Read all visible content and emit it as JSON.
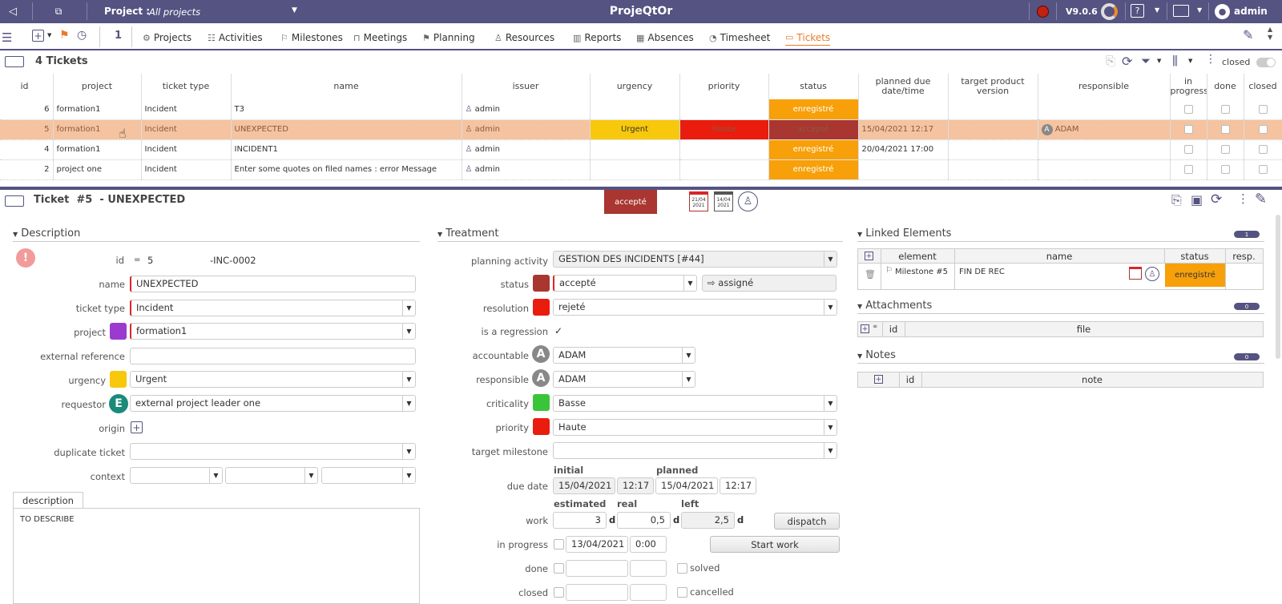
{
  "topbar": {
    "project_label": "Project :",
    "project_value": "All projects",
    "app_title": "ProjeQtOr",
    "version": "V9.0.6",
    "user": "admin"
  },
  "menubar": {
    "number": "1",
    "items": [
      {
        "label": "Projects",
        "icon": "gear-icon"
      },
      {
        "label": "Activities",
        "icon": "activities-icon"
      },
      {
        "label": "Milestones",
        "icon": "flag-icon"
      },
      {
        "label": "Meetings",
        "icon": "meeting-icon"
      },
      {
        "label": "Planning",
        "icon": "planning-icon"
      },
      {
        "label": "Resources",
        "icon": "user-icon"
      },
      {
        "label": "Reports",
        "icon": "reports-icon"
      },
      {
        "label": "Absences",
        "icon": "absence-icon"
      },
      {
        "label": "Timesheet",
        "icon": "timer-icon"
      },
      {
        "label": "Tickets",
        "icon": "ticket-icon"
      }
    ]
  },
  "list": {
    "title": "4 Tickets",
    "closed_label": "closed",
    "columns": [
      "id",
      "project",
      "ticket type",
      "name",
      "issuer",
      "urgency",
      "priority",
      "status",
      "planned due date/time",
      "target product version",
      "responsible",
      "in progress",
      "done",
      "closed"
    ],
    "rows": [
      {
        "id": "6",
        "project": "formation1",
        "type": "Incident",
        "name": "T3",
        "issuer": "admin",
        "urgency": "",
        "priority": "",
        "status": "enregistré",
        "due": "",
        "target": "",
        "responsible": ""
      },
      {
        "id": "5",
        "project": "formation1",
        "type": "Incident",
        "name": "UNEXPECTED",
        "issuer": "admin",
        "urgency": "Urgent",
        "priority": "Haute",
        "status": "accepté",
        "due": "15/04/2021 12:17",
        "target": "",
        "responsible": "ADAM"
      },
      {
        "id": "4",
        "project": "formation1",
        "type": "Incident",
        "name": "INCIDENT1",
        "issuer": "admin",
        "urgency": "",
        "priority": "",
        "status": "enregistré",
        "due": "20/04/2021 17:00",
        "target": "",
        "responsible": ""
      },
      {
        "id": "2",
        "project": "project one",
        "type": "Incident",
        "name": "Enter some quotes on filed names : error Message",
        "issuer": "admin",
        "urgency": "",
        "priority": "",
        "status": "enregistré",
        "due": "",
        "target": "",
        "responsible": ""
      }
    ]
  },
  "detail": {
    "title": "Ticket  #5  - UNEXPECTED",
    "status_badge": "accepté",
    "cal1": "21/04 2021",
    "cal2": "14/04 2021",
    "description": {
      "section": "Description",
      "id_label": "id",
      "id_eq": "=",
      "id_value": "5",
      "ref": "-INC-0002",
      "name_label": "name",
      "name_value": "UNEXPECTED",
      "type_label": "ticket type",
      "type_value": "Incident",
      "project_label": "project",
      "project_value": "formation1",
      "extref_label": "external reference",
      "extref_value": "",
      "urgency_label": "urgency",
      "urgency_value": "Urgent",
      "requestor_label": "requestor",
      "requestor_value": "external project leader one",
      "requestor_initial": "E",
      "origin_label": "origin",
      "duplicate_label": "duplicate ticket",
      "context_label": "context",
      "tab_label": "description",
      "text": "TO DESCRIBE"
    },
    "treatment": {
      "section": "Treatment",
      "planning_label": "planning activity",
      "planning_value": "GESTION DES INCIDENTS [#44]",
      "status_label": "status",
      "status_value": "accepté",
      "next_status": "assigné",
      "resolution_label": "resolution",
      "resolution_value": "rejeté",
      "regression_label": "is a regression",
      "regression_checked": true,
      "accountable_label": "accountable",
      "accountable_value": "ADAM",
      "responsible_label": "responsible",
      "responsible_value": "ADAM",
      "initial_A": "A",
      "criticality_label": "criticality",
      "criticality_value": "Basse",
      "priority_label": "priority",
      "priority_value": "Haute",
      "milestone_label": "target milestone",
      "milestone_value": "",
      "initial_head": "initial",
      "planned_head": "planned",
      "due_label": "due date",
      "due_init_date": "15/04/2021",
      "due_init_time": "12:17",
      "due_plan_date": "15/04/2021",
      "due_plan_time": "12:17",
      "estimated_head": "estimated",
      "real_head": "real",
      "left_head": "left",
      "work_label": "work",
      "work_est": "3",
      "work_real": "0,5",
      "work_left": "2,5",
      "unit": "d",
      "dispatch": "dispatch",
      "inprogress_label": "in progress",
      "inprogress_date": "13/04/2021",
      "inprogress_time": "0:00",
      "startwork": "Start work",
      "done_label": "done",
      "solved_label": "solved",
      "closed_label": "closed",
      "cancelled_label": "cancelled"
    },
    "linked": {
      "section": "Linked Elements",
      "count": "1",
      "cols": [
        "element",
        "name",
        "status",
        "resp."
      ],
      "row": {
        "element": "Milestone #5",
        "name": "FIN DE REC",
        "status": "enregistré",
        "resp": ""
      }
    },
    "attachments": {
      "section": "Attachments",
      "count": "0",
      "cols": [
        "id",
        "file"
      ]
    },
    "notes": {
      "section": "Notes",
      "count": "0",
      "cols": [
        "id",
        "note"
      ]
    }
  },
  "colors": {
    "brand": "#545381",
    "accent": "#e97b2c",
    "status_registered": "#f7a00a",
    "status_accepted": "#a93630",
    "urgent": "#f7c80b",
    "high": "#ea1c0e"
  }
}
